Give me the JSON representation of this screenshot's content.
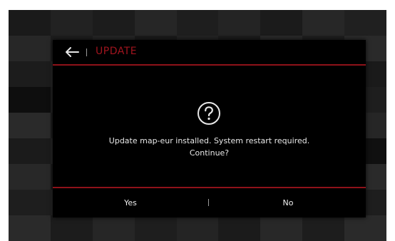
{
  "colors": {
    "accent_red": "#a0141e",
    "divider_red": "#8e1219",
    "dialog_bg": "#000000",
    "text": "#e8e8e8"
  },
  "dialog": {
    "title": "UPDATE",
    "back_icon": "back-arrow-icon",
    "status_icon": "question-circle-icon",
    "message_line1": "Update map-eur installed. System restart required.",
    "message_line2": "Continue?",
    "yes_label": "Yes",
    "no_label": "No"
  }
}
